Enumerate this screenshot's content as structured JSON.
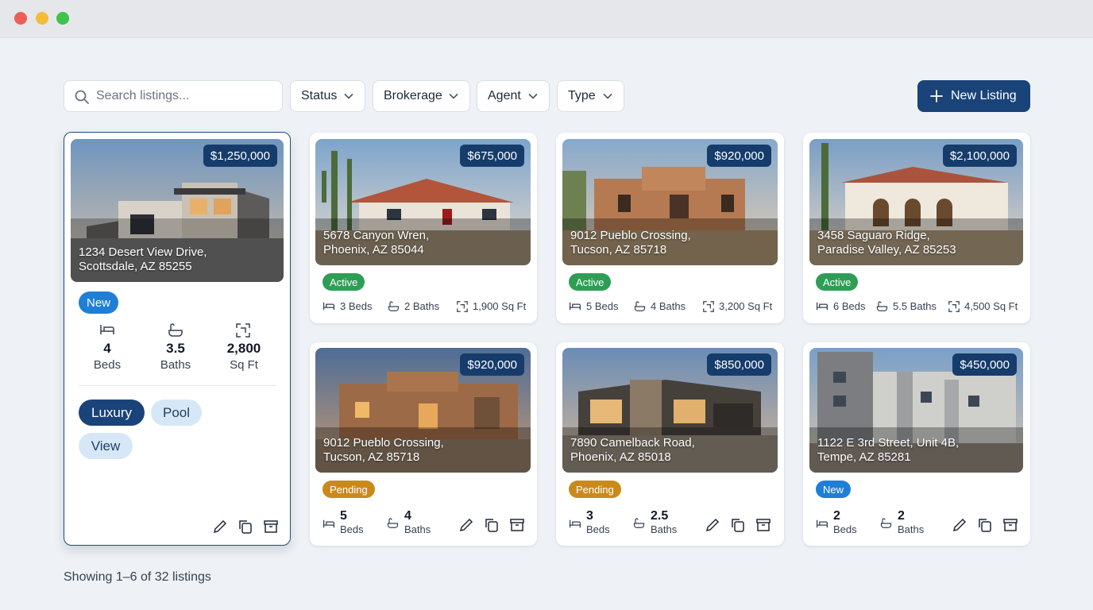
{
  "colors": {
    "accent": "#1a4379",
    "active": "#2e9e55",
    "pending": "#c98a1a",
    "new": "#1f7fd6"
  },
  "toolbar": {
    "search_placeholder": "Search listings...",
    "filters": [
      "Status",
      "Brokerage",
      "Agent",
      "Type"
    ],
    "new_listing_label": "New Listing"
  },
  "selected": {
    "price": "$1,250,000",
    "address_line1": "1234 Desert View Drive,",
    "address_line2": "Scottsdale, AZ 85255",
    "status": "New",
    "beds": "4",
    "beds_label": "Beds",
    "baths": "3.5",
    "baths_label": "Baths",
    "sqft": "2,800",
    "sqft_label": "Sq Ft",
    "tags": [
      "Luxury",
      "Pool",
      "View"
    ]
  },
  "listings": [
    {
      "price": "$675,000",
      "address_line1": "5678 Canyon Wren,",
      "address_line2": "Phoenix, AZ 85044",
      "status": "Active",
      "beds": "3 Beds",
      "baths": "2 Baths",
      "sqft": "1,900 Sq Ft"
    },
    {
      "price": "$920,000",
      "address_line1": "9012 Pueblo Crossing,",
      "address_line2": "Tucson, AZ 85718",
      "status": "Active",
      "beds": "5 Beds",
      "baths": "4 Baths",
      "sqft": "3,200 Sq Ft"
    },
    {
      "price": "$2,100,000",
      "address_line1": "3458 Saguaro Ridge,",
      "address_line2": "Paradise Valley, AZ 85253",
      "status": "Active",
      "beds": "6 Beds",
      "baths": "5.5 Baths",
      "sqft": "4,500 Sq Ft"
    },
    {
      "price": "$920,000",
      "address_line1": "9012 Pueblo Crossing,",
      "address_line2": "Tucson, AZ 85718",
      "status": "Pending",
      "beds": "5",
      "beds_label": "Beds",
      "baths": "4",
      "baths_label": "Baths"
    },
    {
      "price": "$850,000",
      "address_line1": "7890 Camelback Road,",
      "address_line2": "Phoenix, AZ 85018",
      "status": "Pending",
      "beds": "3",
      "beds_label": "Beds",
      "baths": "2.5",
      "baths_label": "Baths"
    },
    {
      "price": "$450,000",
      "address_line1": "1122 E 3rd Street, Unit 4B,",
      "address_line2": "Tempe, AZ 85281",
      "status": "New",
      "beds": "2",
      "beds_label": "Beds",
      "baths": "2",
      "baths_label": "Baths"
    }
  ],
  "footer": {
    "summary": "Showing 1–6 of 32 listings"
  }
}
